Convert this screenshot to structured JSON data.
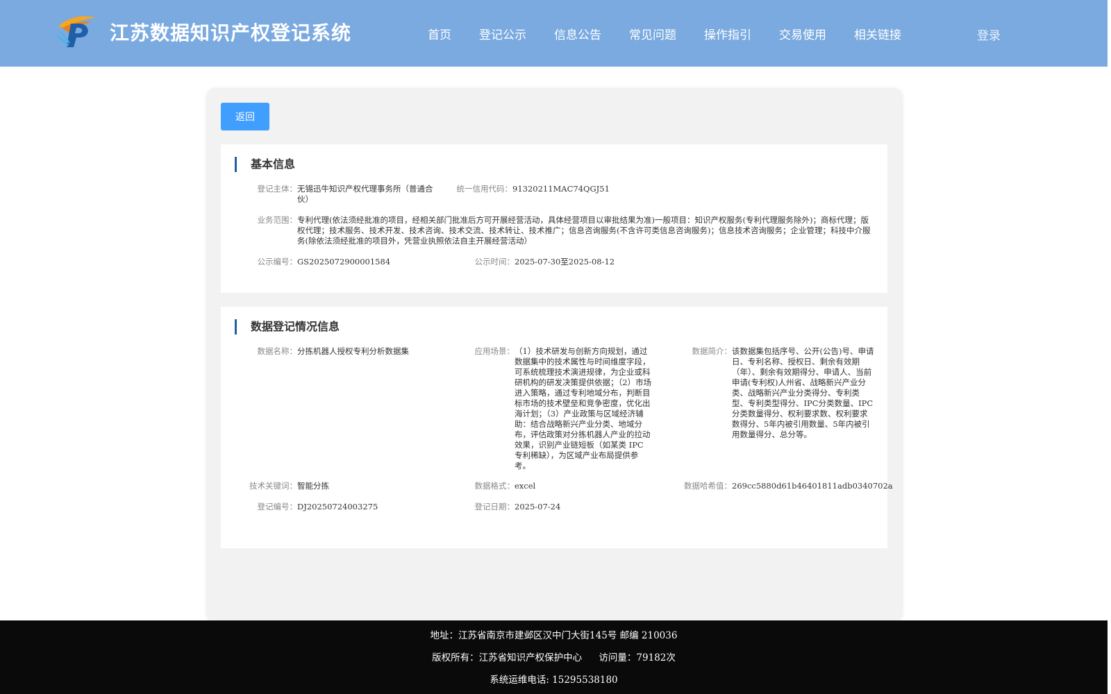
{
  "header": {
    "title": "江苏数据知识产权登记系统",
    "nav": [
      "首页",
      "登记公示",
      "信息公告",
      "常见问题",
      "操作指引",
      "交易使用",
      "相关链接"
    ],
    "login": "登录"
  },
  "back_label": "返回",
  "basic": {
    "title": "基本信息",
    "subject_label": "登记主体：",
    "subject": "无锡迅牛知识产权代理事务所（普通合伙）",
    "credit_label": "统一信用代码：",
    "credit": "91320211MAC74QGJ51",
    "scope_label": "业务范围：",
    "scope": "专利代理(依法须经批准的项目，经相关部门批准后方可开展经营活动，具体经营项目以审批结果为准)一般项目：知识产权服务(专利代理服务除外)；商标代理；版权代理；技术服务、技术开发、技术咨询、技术交流、技术转让、技术推广；信息咨询服务(不含许可类信息咨询服务)；信息技术咨询服务；企业管理；科技中介服务(除依法须经批准的项目外，凭营业执照依法自主开展经营活动）",
    "pub_no_label": "公示编号：",
    "pub_no": "GS2025072900001584",
    "pub_time_label": "公示时间：",
    "pub_time": "2025-07-30至2025-08-12"
  },
  "data_reg": {
    "title": "数据登记情况信息",
    "name_label": "数据名称：",
    "name": "分拣机器人授权专利分析数据集",
    "scene_label": "应用场景：",
    "scene": "（1）技术研发与创新方向规划，通过数据集中的技术属性与时间维度字段，可系统梳理技术演进规律，为企业或科研机构的研发决策提供依据；（2）市场进入策略，通过专利地域分布，判断目标市场的技术壁垒和竞争密度，优化出海计划；（3）产业政策与区域经济辅助：结合战略新兴产业分类、地域分布，评估政策对分拣机器人产业的拉动效果，识别产业链短板（如某类 IPC 专利稀缺），为区域产业布局提供参考。",
    "intro_label": "数据简介：",
    "intro": "该数据集包括序号、公开(公告)号、申请日、专利名称、授权日、剩余有效期（年）、剩余有效期得分、申请人、当前申请(专利权)人州省、战略新兴产业分类、战略新兴产业分类得分、专利类型、专利类型得分、IPC分类数量、IPC分类数量得分、权利要求数、权利要求数得分、5年内被引用数量、5年内被引用数量得分、总分等。",
    "keyword_label": "技术关键词：",
    "keyword": "智能分拣",
    "format_label": "数据格式：",
    "format": "excel",
    "hash_label": "数据哈希值：",
    "hash": "269cc5880d61b46401811adb0340702a",
    "reg_no_label": "登记编号：",
    "reg_no": "DJ20250724003275",
    "reg_date_label": "登记日期：",
    "reg_date": "2025-07-24"
  },
  "footer": {
    "address": "地址：江苏省南京市建邺区汉中门大街145号 邮编 210036",
    "copyright": "版权所有：江苏省知识产权保护中心",
    "visits": "访问量：79182次",
    "support": "系统运维电话: 15295538180"
  },
  "colors": {
    "header_bg": "#7aaae0",
    "button": "#409eff",
    "accent_bar": "#1f5fa8",
    "footer_bg": "#0a0a0a"
  }
}
